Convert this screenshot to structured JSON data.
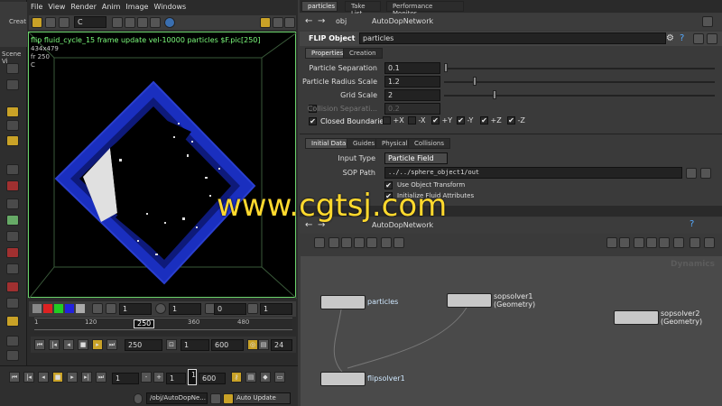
{
  "menu": [
    "File",
    "View",
    "Render",
    "Anim",
    "Image",
    "Windows"
  ],
  "left": {
    "create_label": "Creat",
    "scene_label": "Scene Vi"
  },
  "viewport": {
    "camera_label": "C",
    "title": "flip fluid_cycle_15 frame update vel-10000 particles $F.pic[250]",
    "info1": "434x479",
    "info2": "fr 250",
    "info3": "C"
  },
  "timeline": {
    "field1": "1",
    "field2": "1",
    "field3": "0",
    "field4": "1",
    "ticks": [
      "1",
      "120",
      "250",
      "360",
      "480"
    ],
    "current_frame": "250",
    "frame_field": "250",
    "start_field": "1",
    "end_field": "600",
    "fps_field": "24"
  },
  "bottom": {
    "start": "1",
    "step": "1",
    "frame": "1",
    "end": "600",
    "path": "/obj/AutoDopNe...",
    "update_mode": "Auto Update"
  },
  "params": {
    "pane_tabs": [
      "particles",
      "Take List",
      "Performance Monitor"
    ],
    "path_obj": "obj",
    "path_net": "AutoDopNetwork",
    "node_type": "FLIP Object",
    "node_name": "particles",
    "tabs": [
      "Properties",
      "Creation"
    ],
    "rows": [
      {
        "label": "Particle Separation",
        "value": "0.1"
      },
      {
        "label": "Particle Radius Scale",
        "value": "1.2"
      },
      {
        "label": "Grid Scale",
        "value": "2"
      },
      {
        "label": "Collision Separati...",
        "value": "0.2"
      }
    ],
    "closed_boundaries": "Closed Boundaries",
    "axes": [
      "+X",
      "-X",
      "+Y",
      "-Y",
      "+Z",
      "-Z"
    ],
    "sub_tabs": [
      "Initial Data",
      "Guides",
      "Physical",
      "Collisions"
    ],
    "input_type_label": "Input Type",
    "input_type_value": "Particle Field",
    "sop_path_label": "SOP Path",
    "sop_path_value": "../../sphere_object1/out",
    "use_transform": "Use Object Transform",
    "init_fluid": "Initialize Fluid Attributes"
  },
  "network": {
    "path_net": "AutoDopNetwork",
    "dynamics_label": "Dynamics",
    "nodes": [
      {
        "label": "particles",
        "sub": ""
      },
      {
        "label": "sopsolver1",
        "sub": "(Geometry)"
      },
      {
        "label": "sopsolver2",
        "sub": "(Geometry)"
      },
      {
        "label": "flipsolver1",
        "sub": ""
      }
    ]
  },
  "watermark": "www.cgtsj.com"
}
